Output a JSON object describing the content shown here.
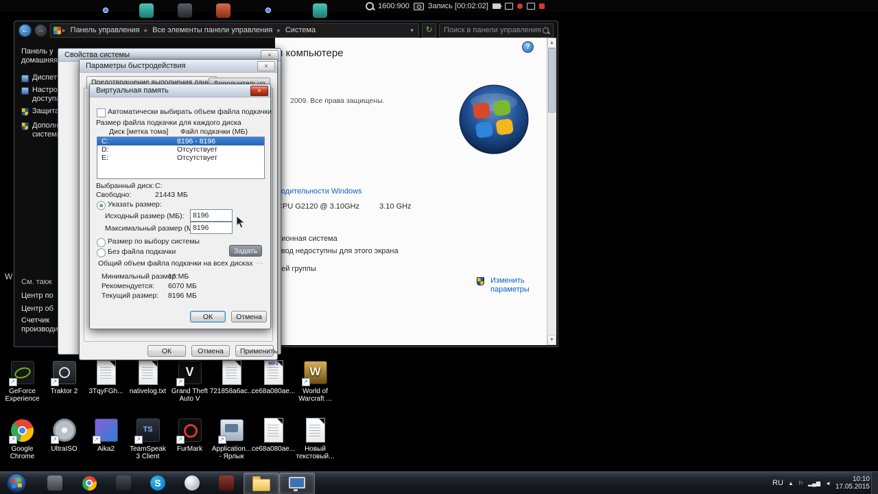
{
  "icons": {
    "back": "←",
    "forward": "→",
    "chevron": "▸",
    "caret": "▾",
    "refresh": "↻",
    "close": "×",
    "help": "?",
    "up_arrow": "▲",
    "down_arrow": "▼",
    "hidden_tray": "▲",
    "tray_flag": "⚐",
    "tray_bars": "▂▄▆",
    "tray_vol": "◄",
    "shortcut_arrow": "↗",
    "gtav_letter": "V",
    "wow_letter": "W",
    "ts_letter": "TS",
    "skype_letter": "S"
  },
  "recording_bar": {
    "resolution": "1600:900",
    "record_label": "Запись [00:02:02]"
  },
  "explorer": {
    "breadcrumb": [
      "Панель управления",
      "Все элементы панели управления",
      "Система"
    ],
    "search_placeholder": "Поиск в панели управления",
    "sidebar": {
      "items": [
        "Панель у домашняя",
        "Диспетче",
        "Настройк доступа",
        "Защита с",
        "Дополни системы"
      ],
      "see_also": [
        "См. такж",
        "Центр по",
        "Центр об",
        "Счетчик производительн"
      ]
    },
    "content": {
      "title_fragment": "и компьютере",
      "copyright_fragment": "2009. Все права защищены.",
      "index_link_fragment": "водительности Windows",
      "cpu_model": "CPU G2120 @ 3.10GHz",
      "cpu_speed": "3.10 GHz",
      "os_fragment": "ционная система",
      "touch_fragment": "ввод недоступны для этого экрана",
      "workgroup_fragment": "ней группы",
      "change_link": "Изменить параметры"
    }
  },
  "system_properties": {
    "title": "Свойства системы"
  },
  "performance_options": {
    "title": "Параметры быстродействия",
    "tabs": [
      "Предотвращение выполнения данных",
      "Дополнительно"
    ],
    "ok": "ОК",
    "cancel": "Отмена",
    "apply": "Применить"
  },
  "virtual_memory": {
    "title": "Виртуальная память",
    "auto_checkbox": "Автоматически выбирать объем файла подкачки",
    "section_label": "Размер файла подкачки для каждого диска",
    "table": {
      "col1": "Диск [метка тома]",
      "col2": "Файл подкачки (МБ)",
      "rows": [
        {
          "disk": "C:",
          "value": "8196 - 8196"
        },
        {
          "disk": "D:",
          "value": "Отсутствует"
        },
        {
          "disk": "E:",
          "value": "Отсутствует"
        }
      ]
    },
    "selected_disk_label": "Выбранный диск:",
    "selected_disk": "C:",
    "free_label": "Свободно:",
    "free_value": "21443 МБ",
    "radio_custom": "Указать размер:",
    "initial_label": "Исходный размер (МБ):",
    "initial_value": "8196",
    "max_label": "Максимальный размер (МБ):",
    "max_value": "8196",
    "radio_system": "Размер по выбору системы",
    "radio_none": "Без файла подкачки",
    "set_button": "Задать",
    "totals_group": "Общий объем файла подкачки на всех дисках",
    "min_label": "Минимальный размер:",
    "min_value": "16 МБ",
    "rec_label": "Рекомендуется:",
    "rec_value": "6070 МБ",
    "cur_label": "Текущий размер:",
    "cur_value": "8196 МБ",
    "ok": "ОК",
    "cancel": "Отмена"
  },
  "desktop": {
    "row1": [
      "GeForce Experience",
      "Traktor 2",
      "3TqyFGh...",
      "nativelog.txt",
      "Grand Theft Auto V",
      "721858a6ac...",
      "ce68a080ae...",
      "World of Warcraft ..."
    ],
    "row2": [
      "Google Chrome",
      "UltraISO",
      "Aika2",
      "TeamSpeak 3 Client",
      "FurMark",
      "Application... - Ярлык",
      "ce68a080ae...",
      "Новый текстовый..."
    ],
    "mp3_badge": "MP3",
    "stray_fragment": "W"
  },
  "taskbar": {
    "language": "RU",
    "time": "10:10",
    "date": "17.05.2015"
  }
}
